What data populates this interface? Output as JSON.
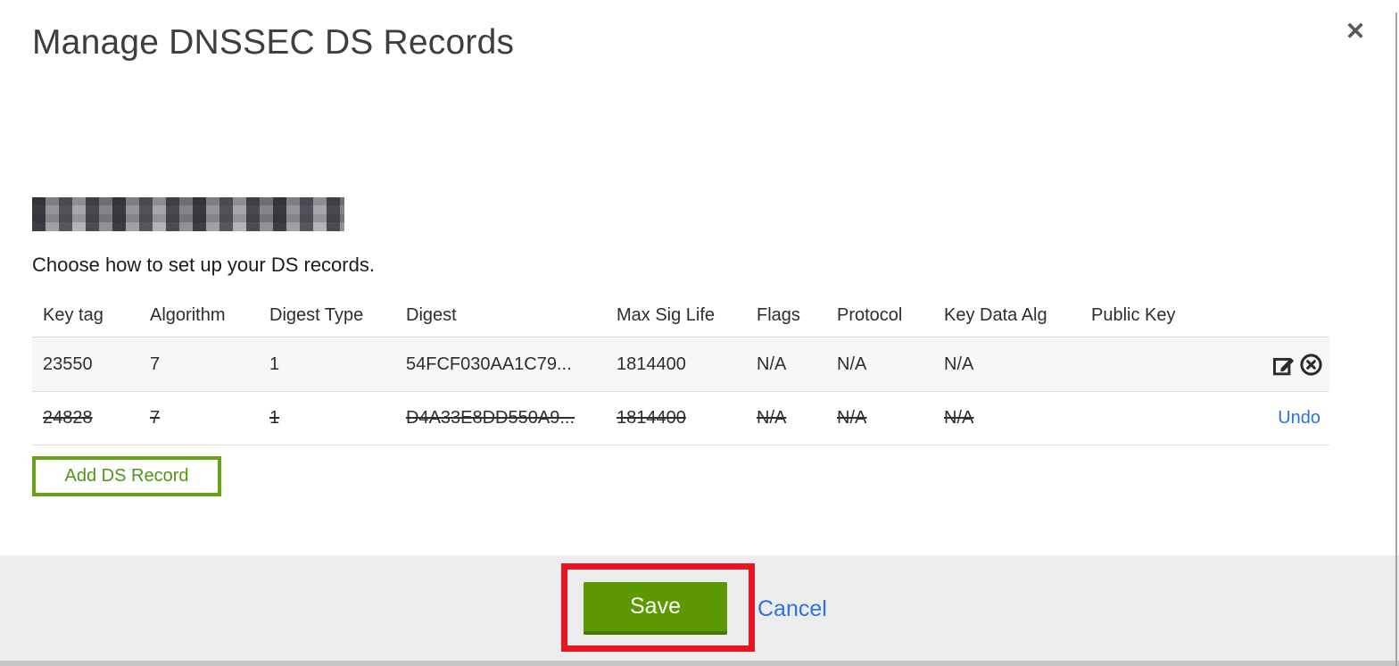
{
  "dialog": {
    "title": "Manage DNSSEC DS Records",
    "close_glyph": "✕",
    "intro": "Choose how to set up your DS records.",
    "domain_redacted": true
  },
  "table": {
    "columns": [
      "Key tag",
      "Algorithm",
      "Digest Type",
      "Digest",
      "Max Sig Life",
      "Flags",
      "Protocol",
      "Key Data Alg",
      "Public Key"
    ],
    "rows": [
      {
        "cells": [
          "23550",
          "7",
          "1",
          "54FCF030AA1C79...",
          "1814400",
          "N/A",
          "N/A",
          "N/A",
          ""
        ],
        "deleted": false,
        "actions": [
          "edit-icon",
          "remove-icon"
        ]
      },
      {
        "cells": [
          "24828",
          "7",
          "1",
          "D4A33E8DD550A9...",
          "1814400",
          "N/A",
          "N/A",
          "N/A",
          ""
        ],
        "deleted": true,
        "action_label": "Undo"
      }
    ]
  },
  "buttons": {
    "add_ds_record": "Add DS Record",
    "save": "Save",
    "cancel": "Cancel"
  },
  "annotation": {
    "type": "highlight-box",
    "target": "save-button",
    "color": "#ea141e"
  },
  "colors": {
    "save_green": "#5c9802",
    "outline_green": "#67a214",
    "link_blue": "#2d73e0",
    "row_alt_bg": "#f7f7f7",
    "footer_bg": "#ececec"
  }
}
